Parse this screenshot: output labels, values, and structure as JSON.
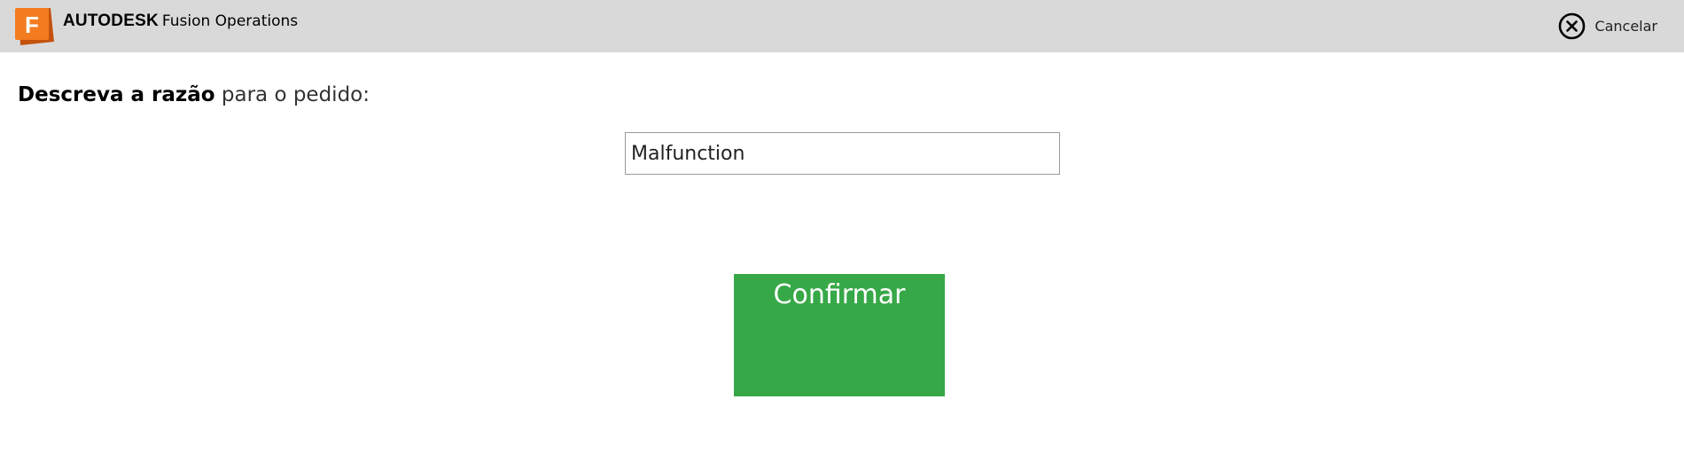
{
  "header": {
    "logo_icon": "fusion-operations-logo-icon",
    "brand_bold": "AUTODESK",
    "brand_product": "Fusion Operations",
    "cancel": {
      "icon": "close-circle-icon",
      "label": "Cancelar"
    },
    "colors": {
      "background": "#d9d9d9",
      "logo_orange": "#f47c20"
    }
  },
  "form": {
    "prompt_strong": "Descreva a razão",
    "prompt_rest": "para o pedido:",
    "reason_value": "Malfunction",
    "confirm_label": "Confirmar",
    "confirm_color": "#37a847"
  }
}
